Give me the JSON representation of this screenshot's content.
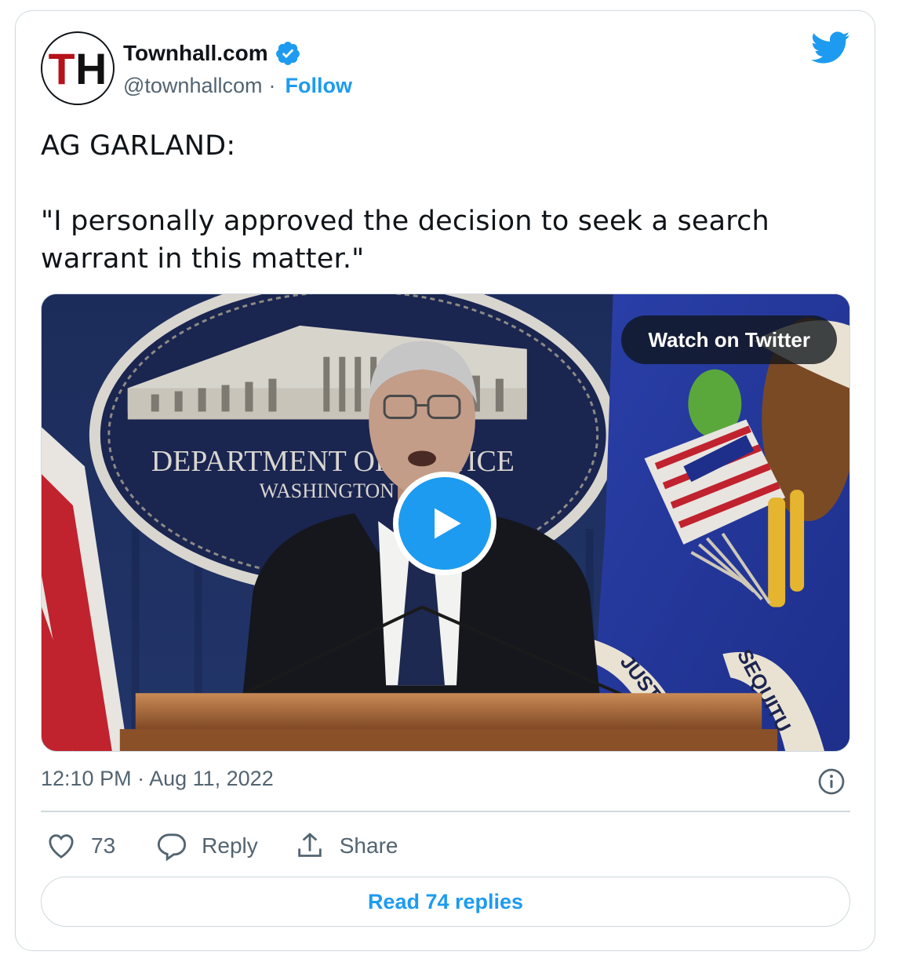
{
  "tweet": {
    "author_name": "Townhall.com",
    "handle": "@townhallcom",
    "separator": "·",
    "follow_label": "Follow",
    "avatar_text": "TH",
    "text": "AG GARLAND:\n\n\"I personally approved the decision to seek a search warrant in this matter.\"",
    "timestamp": "12:10 PM · Aug 11, 2022"
  },
  "media": {
    "watch_label": "Watch on Twitter",
    "seal_text_1": "DEPARTMENT OF JUSTICE",
    "seal_text_2": "WASHINGTON",
    "flag_text_1": "JUSTI",
    "flag_text_2": "SEQUITU"
  },
  "actions": {
    "like_count": "73",
    "reply_label": "Reply",
    "share_label": "Share",
    "read_replies_label": "Read 74 replies"
  },
  "icons": {
    "brand": "twitter-bird-icon",
    "verified": "verified-badge-icon",
    "like": "heart-icon",
    "reply": "speech-bubble-icon",
    "share": "share-upload-icon",
    "info": "info-icon",
    "play": "play-icon"
  },
  "colors": {
    "accent": "#1d9bf0",
    "text": "#0f1419",
    "muted": "#536471",
    "border": "#cfd9de"
  }
}
